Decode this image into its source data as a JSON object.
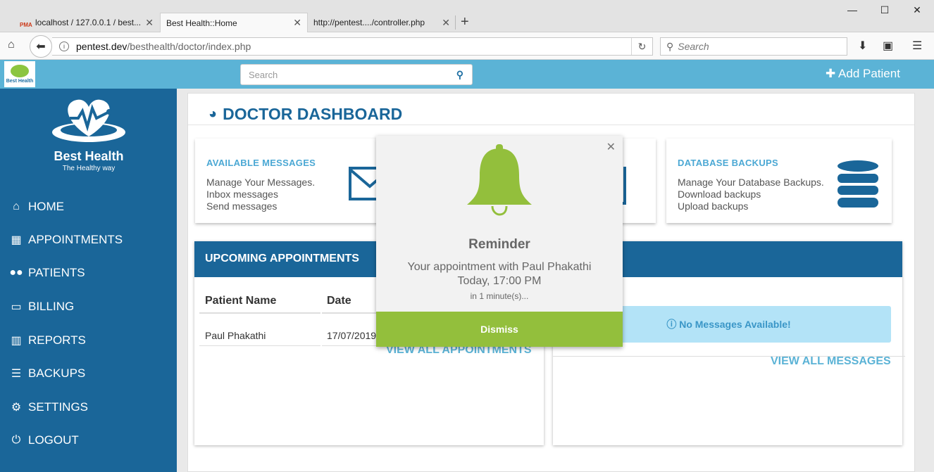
{
  "browser": {
    "tabs": [
      {
        "label": "localhost / 127.0.0.1 / best...",
        "favicon": "PMA"
      },
      {
        "label": "Best Health::Home"
      },
      {
        "label": "http://pentest..../controller.php"
      }
    ],
    "url_host": "pentest.dev",
    "url_path": "/besthealth/doctor/index.php",
    "search_placeholder": "Search"
  },
  "header": {
    "logo_text": "Best Health",
    "search_placeholder": "Search",
    "add_patient": "Add Patient"
  },
  "sidebar": {
    "brand": "Best Health",
    "tagline": "The Healthy way",
    "items": [
      {
        "label": "HOME",
        "icon": "home-icon"
      },
      {
        "label": "APPOINTMENTS",
        "icon": "calendar-icon"
      },
      {
        "label": "PATIENTS",
        "icon": "users-icon"
      },
      {
        "label": "BILLING",
        "icon": "credit-card-icon"
      },
      {
        "label": "REPORTS",
        "icon": "bar-chart-icon"
      },
      {
        "label": "BACKUPS",
        "icon": "database-icon"
      },
      {
        "label": "SETTINGS",
        "icon": "gear-icon"
      },
      {
        "label": "LOGOUT",
        "icon": "power-icon"
      }
    ]
  },
  "dashboard": {
    "title": "DOCTOR DASHBOARD",
    "cards": [
      {
        "title": "AVAILABLE MESSAGES",
        "lines": [
          "Manage Your Messages.",
          "Inbox messages",
          "Send messages"
        ]
      },
      {
        "title": "DATABASE BACKUPS",
        "lines": [
          "Manage Your Database Backups.",
          "Download backups",
          "Upload backups"
        ]
      }
    ],
    "appointments": {
      "title": "UPCOMING APPOINTMENTS",
      "columns": [
        "Patient Name",
        "Date"
      ],
      "rows": [
        [
          "Paul Phakathi",
          "17/07/2019"
        ]
      ],
      "view_all": "VIEW ALL APPOINTMENTS"
    },
    "messages": {
      "title_visible": "S (0)",
      "empty_text": "No Messages Available!",
      "view_all": "VIEW ALL MESSAGES"
    }
  },
  "popup": {
    "title": "Reminder",
    "line1": "Your appointment with Paul Phakathi",
    "line2": "Today, 17:00 PM",
    "line3": "in 1 minute(s)...",
    "dismiss": "Dismiss",
    "accent": "#93bf3c"
  },
  "colors": {
    "sidebar": "#1a6699",
    "header": "#5bb3d6",
    "link": "#5bb3d6"
  }
}
